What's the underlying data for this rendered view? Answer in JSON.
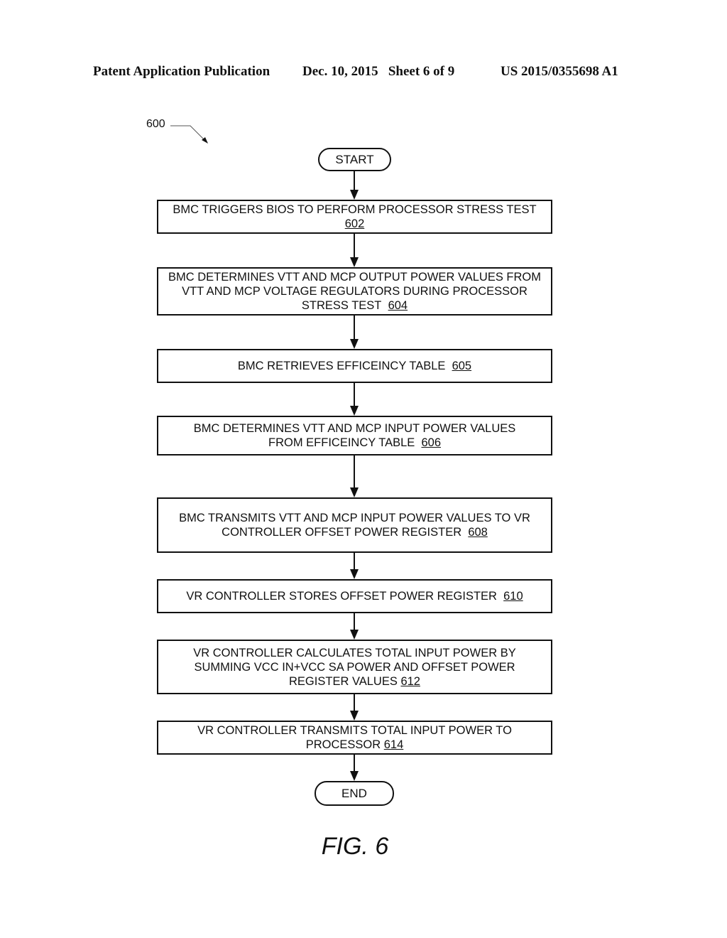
{
  "header": {
    "publication": "Patent Application Publication",
    "date_sheet": "Dec. 10, 2015   Sheet 6 of 9",
    "number": "US 2015/0355698 A1"
  },
  "figure_ref": "600",
  "start_label": "START",
  "end_label": "END",
  "steps": [
    {
      "text": "BMC TRIGGERS BIOS TO PERFORM PROCESSOR STRESS TEST",
      "ref": "602"
    },
    {
      "text": "BMC DETERMINES VTT AND MCP OUTPUT POWER VALUES FROM VTT AND MCP VOLTAGE REGULATORS DURING PROCESSOR STRESS TEST",
      "ref": "604"
    },
    {
      "text": "BMC RETRIEVES EFFICEINCY TABLE",
      "ref": "605"
    },
    {
      "text": "BMC DETERMINES VTT AND MCP INPUT POWER VALUES FROM EFFICEINCY TABLE",
      "ref": "606"
    },
    {
      "text": "BMC TRANSMITS VTT AND MCP INPUT POWER VALUES TO VR CONTROLLER OFFSET POWER REGISTER",
      "ref": "608"
    },
    {
      "text": "VR CONTROLLER STORES OFFSET POWER REGISTER",
      "ref": "610"
    },
    {
      "text": "VR CONTROLLER CALCULATES TOTAL INPUT POWER BY SUMMING VCC IN+VCC SA POWER AND OFFSET POWER REGISTER VALUES",
      "ref": "612"
    },
    {
      "text": "VR CONTROLLER TRANSMITS TOTAL INPUT POWER TO PROCESSOR",
      "ref": "614"
    }
  ],
  "caption": "FIG. 6"
}
